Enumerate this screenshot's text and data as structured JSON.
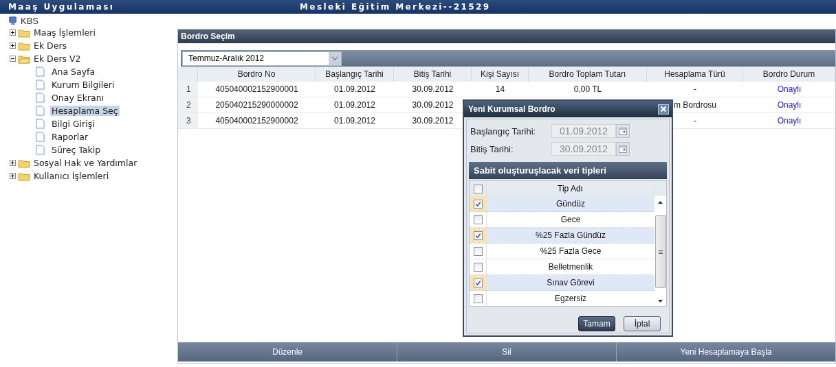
{
  "app_bar": {
    "title": "Maaş Uygulaması",
    "center": "Mesleki Eğitim Merkezi--21529"
  },
  "sidebar": {
    "root": "KBS",
    "items": [
      {
        "label": "Maaş İşlemleri",
        "expanded": false,
        "selected": false
      },
      {
        "label": "Ek Ders",
        "expanded": false,
        "selected": false
      },
      {
        "label": "Ek Ders V2",
        "expanded": true,
        "selected": false,
        "children": [
          {
            "label": "Ana Sayfa",
            "selected": false
          },
          {
            "label": "Kurum Bilgileri",
            "selected": false
          },
          {
            "label": "Onay Ekranı",
            "selected": false
          },
          {
            "label": "Hesaplama Seç",
            "selected": true
          },
          {
            "label": "Bilgi Girişi",
            "selected": false
          },
          {
            "label": "Raporlar",
            "selected": false
          },
          {
            "label": "Süreç Takip",
            "selected": false
          }
        ]
      },
      {
        "label": "Sosyal Hak ve Yardımlar",
        "expanded": false,
        "selected": false
      },
      {
        "label": "Kullanıcı İşlemleri",
        "expanded": false,
        "selected": false
      }
    ]
  },
  "panel": {
    "title": "Bordro Seçim",
    "period": "Temmuz-Aralık 2012",
    "table": {
      "columns": [
        "Bordro No",
        "Başlangıç Tarihi",
        "Bitiş Tarihi",
        "Kişi Sayısı",
        "Bordro Toplam Tutarı",
        "Hesaplama Türü",
        "Bordro Durum"
      ],
      "rows": [
        {
          "index": "1",
          "cells": [
            "405040002152900001",
            "01.09.2012",
            "30.09.2012",
            "14",
            "0,00 TL",
            "-",
            "Onaylı"
          ]
        },
        {
          "index": "2",
          "cells": [
            "205040215290000002",
            "01.09.2012",
            "30.09.2012",
            null,
            null,
            "m Bordrosu",
            "Onaylı"
          ]
        },
        {
          "index": "3",
          "cells": [
            "405040002152900002",
            "01.09.2012",
            "30.09.2012",
            null,
            null,
            "-",
            "Onaylı"
          ]
        }
      ]
    },
    "footer_buttons": [
      "Düzenle",
      "Sil",
      "Yeni Hesaplamaya Başla"
    ]
  },
  "dialog": {
    "title": "Yeni Kurumsal Bordro",
    "fields": [
      {
        "label": "Başlangıç Tarihi:",
        "value": "01.09.2012"
      },
      {
        "label": "Bitiş Tarihi:",
        "value": "30.09.2012"
      }
    ],
    "section": "Sabit oluşturuşlacak veri tipleri",
    "grid": {
      "header": "Tip Adı",
      "all_checked": false,
      "rows": [
        {
          "label": "Gündüz",
          "checked": true
        },
        {
          "label": "Gece",
          "checked": false
        },
        {
          "label": "%25 Fazla Gündüz",
          "checked": true
        },
        {
          "label": "%25 Fazla Gece",
          "checked": false
        },
        {
          "label": "Belletmenlik",
          "checked": false
        },
        {
          "label": "Sınav Görevi",
          "checked": true
        },
        {
          "label": "Egzersiz",
          "checked": false
        }
      ]
    },
    "buttons": [
      {
        "label": "Tamam",
        "kind": "primary"
      },
      {
        "label": "İptal",
        "kind": "secondary"
      }
    ]
  }
}
